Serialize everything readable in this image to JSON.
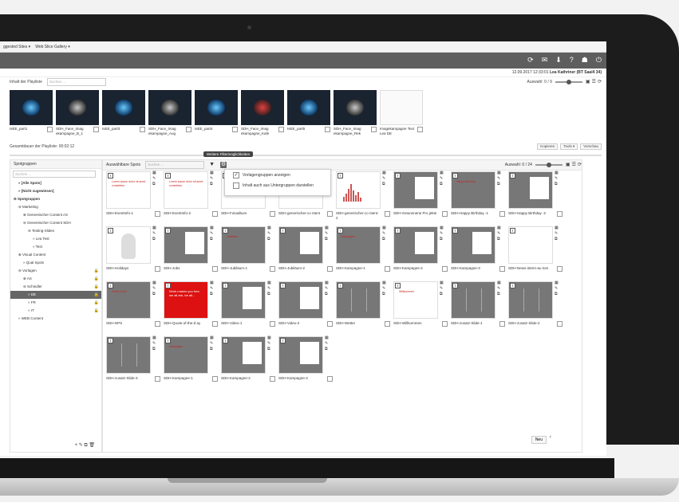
{
  "browser": {
    "tabs": [
      "ggested Sites ▾",
      "Web Slice Gallery ▾"
    ]
  },
  "app": {
    "topbar_icons": [
      "refresh-icon",
      "mail-icon",
      "download-icon",
      "help-icon",
      "user-icon",
      "logout-icon"
    ],
    "session_text": "12.09.2017 12:33:01",
    "user_name": "Lea Kathriner (BT Saal4 34)"
  },
  "playlist": {
    "title": "Inhalt der Playliste",
    "search_placeholder": "Suchen ...",
    "selection": "Auswahl: 0 / 9",
    "items": [
      {
        "label": "IsEE_part1",
        "style": "blue"
      },
      {
        "label": "SDH_Face_Imag ekampagne_B_1",
        "style": "dark"
      },
      {
        "label": "IsEE_part3",
        "style": "blue"
      },
      {
        "label": "SDH_Face_Imag ekampagne_Aug",
        "style": "dark"
      },
      {
        "label": "IsEE_part4",
        "style": "blue"
      },
      {
        "label": "SDH_Face_Imag ekampagne_Kafe",
        "style": "red"
      },
      {
        "label": "IsEE_part5",
        "style": "blue"
      },
      {
        "label": "SDH_Face_Imag ekampagne_Rek",
        "style": "dark"
      },
      {
        "label": "Imagekampagne Text Lea DE",
        "style": "white"
      }
    ],
    "duration_label": "Gesamtdauer der Playliste: 00:02:12",
    "buttons": [
      "Kopieren",
      "Tools ▾",
      "Vorschau"
    ]
  },
  "tooltip": "Weitere Filtermöglichkeiten",
  "groups": {
    "title": "Spotgruppen",
    "search_placeholder": "Suchen ...",
    "tree": [
      {
        "label": "» [Alle Spots]",
        "indent": 1,
        "bold": true
      },
      {
        "label": "» [Nicht zugewiesen]",
        "indent": 1,
        "bold": true
      },
      {
        "label": "⊖ Spotgruppen",
        "indent": 0,
        "bold": true
      },
      {
        "label": "⊖ Marketing",
        "indent": 1
      },
      {
        "label": "⊕ Genereischer Content AS",
        "indent": 2
      },
      {
        "label": "⊖ Genereischer Content SDH",
        "indent": 2
      },
      {
        "label": "⊖ Testing-Slides",
        "indent": 3
      },
      {
        "label": "» Lea Test",
        "indent": 4
      },
      {
        "label": "» Test",
        "indent": 4
      },
      {
        "label": "⊕ Visual Content",
        "indent": 1
      },
      {
        "label": "» Qual Spots",
        "indent": 2
      },
      {
        "label": "⊖ Vorlagen",
        "indent": 1,
        "lock": true
      },
      {
        "label": "⊕ AS",
        "indent": 2,
        "lock": true
      },
      {
        "label": "⊖ Schindler",
        "indent": 2,
        "lock": true
      },
      {
        "label": "» DE",
        "indent": 3,
        "lock": true,
        "selected": true
      },
      {
        "label": "» FR",
        "indent": 3,
        "lock": true
      },
      {
        "label": "» IT",
        "indent": 3,
        "lock": true
      },
      {
        "label": "» WEB Content",
        "indent": 1
      }
    ],
    "tools": "+ ✎ ⧉ 🗑"
  },
  "spots": {
    "title": "Auswählbare Spots",
    "search_placeholder": "Suchen ...",
    "selection": "Auswahl: 0 / 24",
    "filter_menu": [
      {
        "label": "Vorlagengruppen anzeigen",
        "checked": true
      },
      {
        "label": "Inhalt auch aus Untergruppen darstellen",
        "checked": false
      }
    ],
    "items": [
      {
        "label": "SDH-EventInfo-1",
        "style": "white",
        "text": "Lorem ipsum dolor sit amet, consetetur"
      },
      {
        "label": "SDH-EventInfo-2",
        "style": "white",
        "text": "Lorem ipsum dolor sit amet, consetetur"
      },
      {
        "label": "SDH-Fotoalbum",
        "style": "white",
        "text": ""
      },
      {
        "label": "SDH-generischer-co ntent",
        "style": "white",
        "text": ""
      },
      {
        "label": "SDH-generischer-co ntent-2",
        "style": "chart",
        "text": ""
      },
      {
        "label": "SDH-Gewonnene Pro jekte",
        "style": "gray",
        "text": ""
      },
      {
        "label": "SDH-Happy Birthday -1",
        "style": "gray",
        "text": "Happy Birthday"
      },
      {
        "label": "SDH-Happy Birthday -2",
        "style": "gray",
        "text": ""
      },
      {
        "label": "SDH-Holidays",
        "style": "bunny",
        "text": ""
      },
      {
        "label": "SDH-Jobs",
        "style": "gray",
        "text": ""
      },
      {
        "label": "SDH-Jubiläum-1",
        "style": "gray",
        "text": "Jubiläum"
      },
      {
        "label": "SDH-Jubiläum-2",
        "style": "gray",
        "text": ""
      },
      {
        "label": "SDH-Kampagne-1",
        "style": "gray",
        "text": "Kampagne"
      },
      {
        "label": "SDH-Kampagne-2",
        "style": "gray",
        "text": ""
      },
      {
        "label": "SDH-Kampagne-3",
        "style": "gray",
        "text": ""
      },
      {
        "label": "SDH-News-intern-au tom",
        "style": "white",
        "text": ""
      },
      {
        "label": "SDH-NPS",
        "style": "gray",
        "text": "Vielen Dank"
      },
      {
        "label": "SDH-Quote-of-the-d ay",
        "style": "red",
        "text": "Work makes you free, we all are, be all..."
      },
      {
        "label": "SDH-Video-1",
        "style": "gray",
        "text": ""
      },
      {
        "label": "SDH-Video-2",
        "style": "gray",
        "text": ""
      },
      {
        "label": "SDH-Wetter",
        "style": "split",
        "text": ""
      },
      {
        "label": "SDH-Willkommen",
        "style": "white",
        "text": "Willkommen"
      },
      {
        "label": "SDH-zusatz-Slide-1",
        "style": "split",
        "text": ""
      },
      {
        "label": "SDH-zusatz-Slide-2",
        "style": "split",
        "text": ""
      },
      {
        "label": "SDH-zusatz-Slide-3",
        "style": "split",
        "text": ""
      },
      {
        "label": "SDH-Kampagne-1",
        "style": "gray",
        "text": "Kampagne"
      },
      {
        "label": "SDH-Kampagne-2",
        "style": "gray",
        "text": ""
      },
      {
        "label": "SDH-Kampagne-3",
        "style": "gray",
        "text": ""
      }
    ],
    "new_button": "Neu"
  }
}
